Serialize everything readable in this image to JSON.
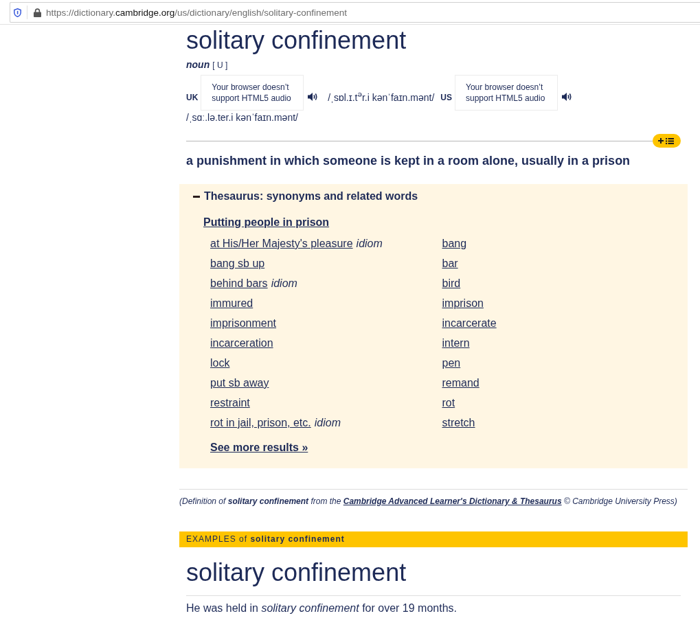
{
  "address_bar": {
    "url": [
      {
        "text": "https://dictionary.",
        "highlight": false
      },
      {
        "text": "cambridge.org",
        "highlight": true
      },
      {
        "text": "/us/dictionary/english/solitary-confinement",
        "highlight": false
      }
    ]
  },
  "entry": {
    "headword": "solitary confinement",
    "part_of_speech": "noun",
    "grammar": "[ U ]",
    "pronunciations": [
      {
        "region": "UK",
        "audio_message": "Your browser doesn’t support HTML5 audio",
        "ipa": "/ˌsɒl.ɪ.t$^{ə}$r.i kənˈfaɪn.mənt/"
      },
      {
        "region": "US",
        "audio_message": "Your browser doesn’t support HTML5 audio",
        "ipa": "/ˌsɑː.lə.ter.i kənˈfaɪn.mənt/"
      }
    ],
    "definition": "a punishment in which someone is kept in a room alone, usually in a prison"
  },
  "thesaurus": {
    "expanded": true,
    "title": "Thesaurus: synonyms and related words",
    "group_title": "Putting people in prison",
    "columns": [
      [
        {
          "label": "at His/Her Majesty's pleasure",
          "note": "idiom"
        },
        {
          "label": "bang sb up"
        },
        {
          "label": "behind bars",
          "note": "idiom"
        },
        {
          "label": "immured"
        },
        {
          "label": "imprisonment"
        },
        {
          "label": "incarceration"
        },
        {
          "label": "lock"
        },
        {
          "label": "put sb away"
        },
        {
          "label": "restraint"
        },
        {
          "label": "rot in jail, prison, etc.",
          "note": "idiom"
        }
      ],
      [
        {
          "label": "bang"
        },
        {
          "label": "bar"
        },
        {
          "label": "bird"
        },
        {
          "label": "imprison"
        },
        {
          "label": "incarcerate"
        },
        {
          "label": "intern"
        },
        {
          "label": "pen"
        },
        {
          "label": "remand"
        },
        {
          "label": "rot"
        },
        {
          "label": "stretch"
        }
      ]
    ],
    "more_link": "See more results »"
  },
  "citation": {
    "before": "(Definition of **solitary confinement** from the",
    "link": "Cambridge Advanced Learner's Dictionary & Thesaurus",
    "after": "© Cambridge University Press)"
  },
  "examples": {
    "header": "EXAMPLES of **solitary confinement**",
    "headword": "solitary confinement",
    "sentences": [
      "He was held in *solitary confinement* for over 19 months."
    ]
  }
}
